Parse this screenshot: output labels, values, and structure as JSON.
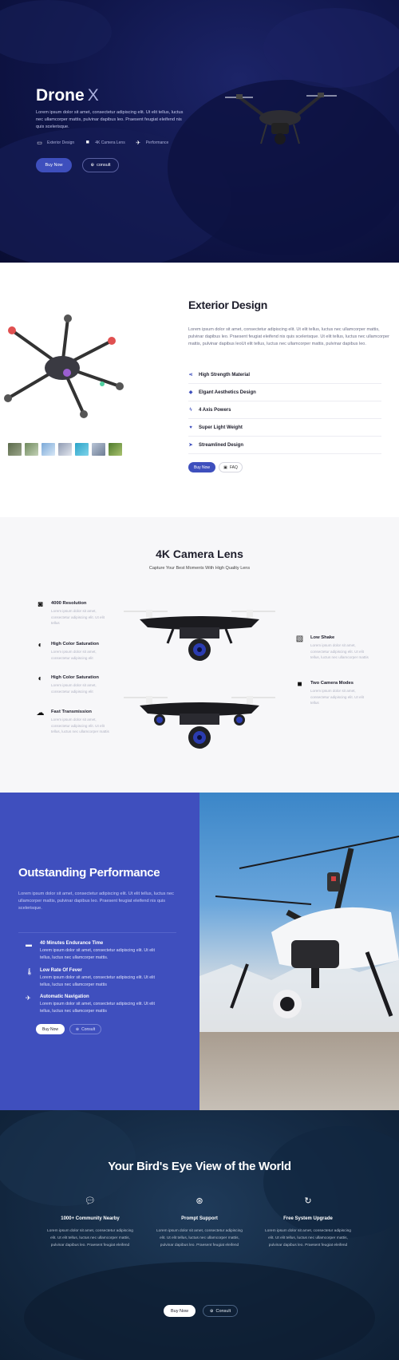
{
  "hero": {
    "title": "Drone",
    "title_x": "X",
    "description": "Lorem ipsum dolor sit amet, consectetur adipiscing elit. Ut elit tellus, luctus nec ullamcorper mattis, pulvinar dapibus leo. Praesent feugiat eleifend nis quis scelerisque.",
    "features": [
      {
        "icon": "monitor-icon",
        "label": "Exterior Design"
      },
      {
        "icon": "video-camera-icon",
        "label": "4K Camera Lens"
      },
      {
        "icon": "airplane-icon",
        "label": "Performance"
      }
    ],
    "buy_label": "Buy Now",
    "consult_label": "consult"
  },
  "exterior": {
    "title": "Exterior Design",
    "description": "Lorem ipsum dolor sit amet, consectetur adipiscing elit. Ut elit tellus, luctus nec ullamcorper mattis, pulvinar dapibus leo. Praesent feugiat eleifend nis quis scelerisque. Ut elit tellus, luctus nec ullamcorper mattis, pulvinar dapibus leoUt elit tellus, luctus nec ullamcorper mattis, pulvinar dapibus leo.",
    "items": [
      {
        "icon": "share-icon",
        "label": "High Strength Material"
      },
      {
        "icon": "tag-icon",
        "label": "Elgant Aesthetics Design"
      },
      {
        "icon": "bolt-icon",
        "label": "4 Axis Powers"
      },
      {
        "icon": "heart-icon",
        "label": "Super Light Weight"
      },
      {
        "icon": "send-icon",
        "label": "Streamlined Design"
      }
    ],
    "buy_label": "Buy Now",
    "faq_label": "FAQ"
  },
  "camera": {
    "title": "4K Camera Lens",
    "subtitle": "Capture Your Best Moments With High Quality Lens",
    "left_features": [
      {
        "icon": "camera-icon",
        "title": "4000 Resolution",
        "desc": "Lorem ipsum dolor sit amet, consectetur adipiscing elit. Ut elit tellus"
      },
      {
        "icon": "contrast-icon",
        "title": "High Color Saturation",
        "desc": "Lorem ipsum dolor sit amet, consectetur adipiscing elit"
      },
      {
        "icon": "contrast-icon",
        "title": "High Color Saturation",
        "desc": "Lorem ipsum dolor sit amet, consectetur adipiscing elit"
      },
      {
        "icon": "cloud-upload-icon",
        "title": "Fast Transmission",
        "desc": "Lorem ipsum dolor sit amet, consectetur adipiscing elit. Ut elit tellus, luctus nec ullamcorper mattis"
      }
    ],
    "right_features": [
      {
        "icon": "image-icon",
        "title": "Low Shake",
        "desc": "Lorem ipsum dolor sit amet, consectetur adipiscing elit. Ut elit tellus, luctus nec ullamcorper mattis"
      },
      {
        "icon": "video-camera-icon",
        "title": "Two Camera Modes",
        "desc": "Lorem ipsum dolor sit amet, consectetur adipiscing elit. Ut elit tellus"
      }
    ]
  },
  "performance": {
    "title": "Outstanding Performance",
    "description": "Lorem ipsum dolor sit amet, consectetur adipiscing elit. Ut elit tellus, luctus nec ullamcorper mattis, pulvinar dapibus leo. Praesent feugiat eleifend nis quis scelerisque.",
    "items": [
      {
        "icon": "battery-icon",
        "title": "40 Minutes Endurance Time",
        "desc": "Lorem ipsum dolor sit amet, consectetur adipiscing elit. Ut elit tellus, luctus nec ullamcorper mattis."
      },
      {
        "icon": "thermometer-icon",
        "title": "Low Rate Of Fever",
        "desc": "Lorem ipsum dolor sit amet, consectetur adipiscing elit. Ut elit tellus, luctus nec ullamcorper mattis"
      },
      {
        "icon": "plane-icon",
        "title": "Automatic Navigation",
        "desc": "Lorem ipsum dolor sit amet, consectetur adipiscing elit. Ut elit tellus, luctus nec ullamcorper mattis"
      }
    ],
    "buy_label": "Buy Now",
    "consult_label": "Consult"
  },
  "bird": {
    "title": "Your Bird's Eye View of the World",
    "columns": [
      {
        "icon": "chat-icon",
        "title": "1000+ Community Nearby",
        "desc": "Lorem ipsum dolor sit amet, consectetur adipiscing elit. Ut elit tellus, luctus nec ullamcorper mattis, pulvinar dapibus leo. Praesent feugiat eleifend"
      },
      {
        "icon": "lifebuoy-icon",
        "title": "Prompt Support",
        "desc": "Lorem ipsum dolor sit amet, consectetur adipiscing elit. Ut elit tellus, luctus nec ullamcorper mattis, pulvinar dapibus leo. Praesent feugiat eleifend"
      },
      {
        "icon": "refresh-icon",
        "title": "Free System Upgrade",
        "desc": "Lorem ipsum dolor sit amet, consectetur adipiscing elit. Ut elit tellus, luctus nec ullamcorper mattis, pulvinar dapibus leo. Praesent feugiat eleifend"
      }
    ],
    "buy_label": "Buy Now",
    "consult_label": "Consult"
  },
  "colors": {
    "accent": "#3e4fbd",
    "hero_bg": "#0f1548",
    "bird_bg": "#152b45"
  }
}
